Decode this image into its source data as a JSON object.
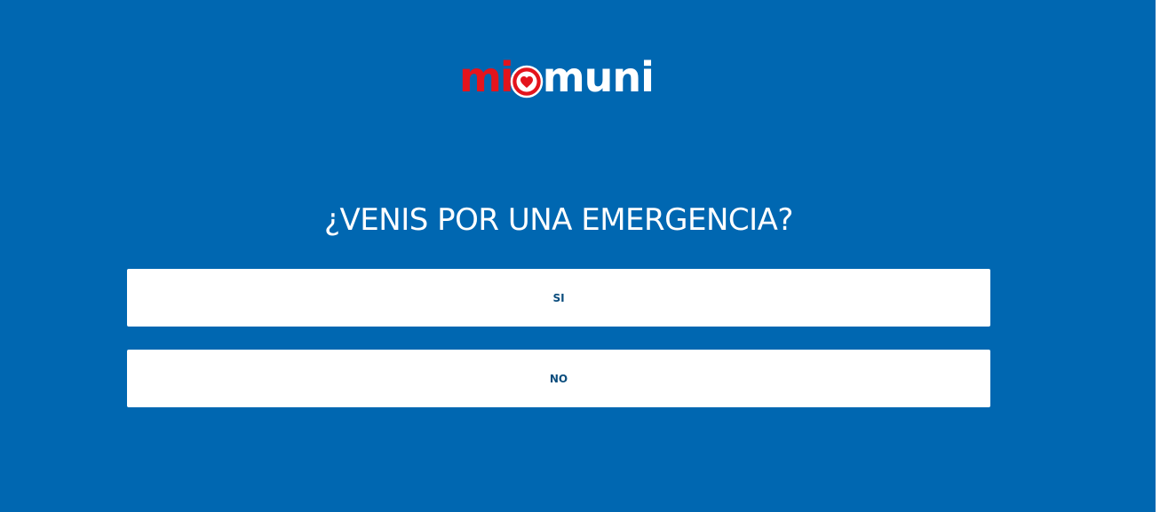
{
  "logo": {
    "part1": "mi",
    "part2": "muni",
    "heart_icon": "heart-icon"
  },
  "question": "¿VENIS POR UNA EMERGENCIA?",
  "options": {
    "yes_label": "SI",
    "no_label": "NO"
  },
  "colors": {
    "background": "#0067b1",
    "logo_red": "#e4141c",
    "button_bg": "#ffffff",
    "button_text": "#0b4d7d"
  }
}
